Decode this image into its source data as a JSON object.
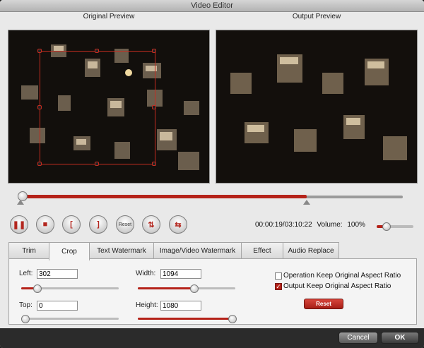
{
  "window": {
    "title": "Video Editor"
  },
  "previews": {
    "original_label": "Original Preview",
    "output_label": "Output Preview"
  },
  "controls": {
    "reset_small_label": "Reset",
    "timecode": "00:00:19/03:10:22",
    "volume_label": "Volume:",
    "volume_value": "100%"
  },
  "tabs": [
    {
      "label": "Trim"
    },
    {
      "label": "Crop"
    },
    {
      "label": "Text Watermark"
    },
    {
      "label": "Image/Video Watermark"
    },
    {
      "label": "Effect"
    },
    {
      "label": "Audio Replace"
    }
  ],
  "crop": {
    "left_label": "Left:",
    "left_value": "302",
    "top_label": "Top:",
    "top_value": "0",
    "width_label": "Width:",
    "width_value": "1094",
    "height_label": "Height:",
    "height_value": "1080",
    "keep_original_label": "Operation Keep Original Aspect Ratio",
    "keep_output_label": "Output Keep Original Aspect Ratio",
    "reset_label": "Reset"
  },
  "footer": {
    "cancel_label": "Cancel",
    "ok_label": "OK"
  },
  "colors": {
    "accent": "#b52219"
  }
}
